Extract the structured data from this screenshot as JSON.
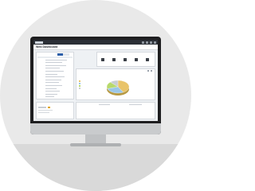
{
  "window": {
    "app_brand": "",
    "page_title": "Web Dashboard"
  },
  "left_panel": {
    "title": "",
    "tabs": [
      {
        "label": "",
        "active": true
      },
      {
        "label": "",
        "active": false
      }
    ],
    "rows": [
      {
        "label": "",
        "level": 0.9
      },
      {
        "label": "",
        "level": 0.7
      },
      {
        "label": "",
        "level": 0.85
      },
      {
        "label": "",
        "level": 0.6
      },
      {
        "label": "",
        "level": 0.75
      },
      {
        "label": "",
        "level": 0.5
      },
      {
        "label": "",
        "level": 0.8
      },
      {
        "label": "",
        "level": 0.65
      },
      {
        "label": "",
        "level": 0.55
      },
      {
        "label": "",
        "level": 0.7
      },
      {
        "label": "",
        "level": 0.45
      },
      {
        "label": "",
        "level": 0.6
      },
      {
        "label": "",
        "level": 0.5
      },
      {
        "label": "",
        "level": 0.35
      }
    ]
  },
  "right_panel": {
    "title": "",
    "buttons": [
      {
        "label": "",
        "icon": "image-icon"
      },
      {
        "label": "",
        "icon": "grid-icon"
      },
      {
        "label": "",
        "icon": "flag-icon"
      },
      {
        "label": "",
        "icon": "settings-icon"
      },
      {
        "label": "",
        "icon": "share-icon"
      }
    ]
  },
  "chart_panel": {
    "title": "",
    "chart_data": {
      "type": "pie",
      "title": "",
      "slices": [
        {
          "label": "",
          "value": 42,
          "color": "#e9c46a"
        },
        {
          "label": "",
          "value": 28,
          "color": "#9bc7e8"
        },
        {
          "label": "",
          "value": 18,
          "color": "#b7d96b"
        },
        {
          "label": "",
          "value": 12,
          "color": "#c9cdd2"
        }
      ],
      "legend": "left"
    }
  },
  "bottom_left_panel": {
    "title": ""
  },
  "bottom_right_panel": {
    "title": ""
  },
  "colors": {
    "accent": "#2d5fa8",
    "chrome": "#2b2f36",
    "highlight": "#e0a400"
  }
}
